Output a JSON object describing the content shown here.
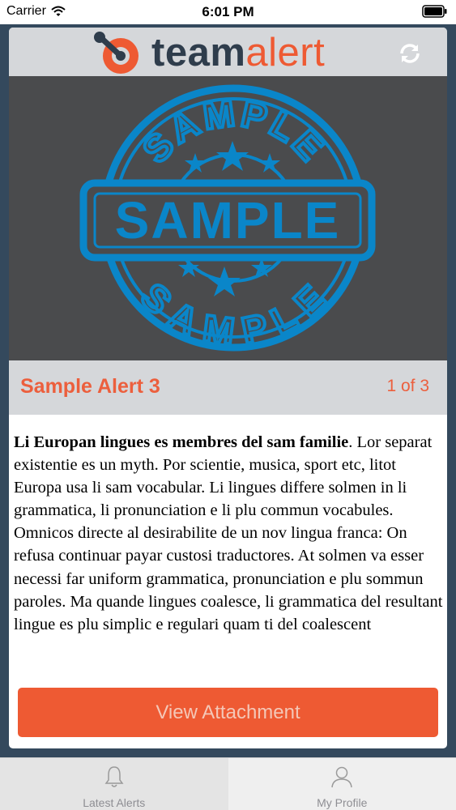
{
  "status_bar": {
    "carrier": "Carrier",
    "time": "6:01 PM"
  },
  "header": {
    "logo_team": "team",
    "logo_alert": "alert"
  },
  "media": {
    "stamp_text": "SAMPLE",
    "stamp_color": "#0a86c9"
  },
  "alert": {
    "title": "Sample Alert 3",
    "counter": "1 of 3",
    "lead": "Li Europan lingues es membres del sam familie",
    "body": ". Lor separat existentie es un myth. Por scientie, musica, sport etc, litot Europa usa li sam vocabular. Li lingues differe solmen in li grammatica, li pronunciation e li plu commun vocabules. Omnicos directe al desirabilite de un nov lingua franca: On refusa continuar payar custosi traductores. At solmen va esser necessi far uniform grammatica, pronunciation e plu sommun paroles. Ma quande lingues coalesce, li grammatica del resultant lingue es plu simplic e regulari quam ti del coalescent"
  },
  "actions": {
    "view_attachment": "View Attachment"
  },
  "tabs": [
    {
      "label": "Latest Alerts",
      "icon": "bell-icon"
    },
    {
      "label": "My Profile",
      "icon": "user-icon"
    }
  ],
  "colors": {
    "accent": "#ee5a33",
    "dark": "#34495d",
    "header_bg": "#d5d7da"
  }
}
